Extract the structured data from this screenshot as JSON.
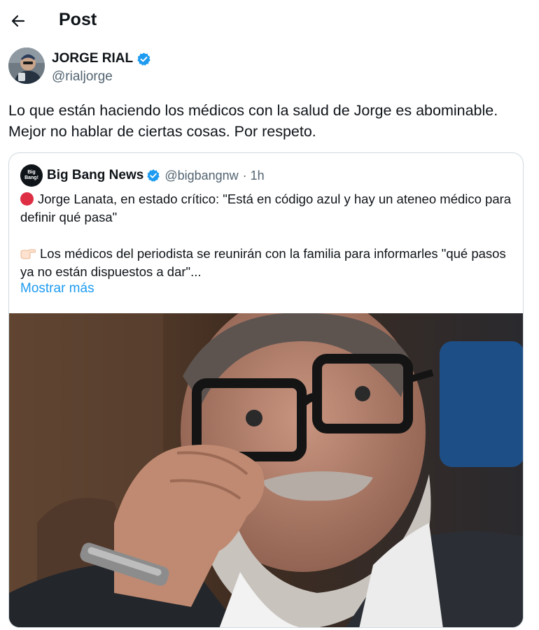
{
  "header": {
    "back_icon": "arrow-left-icon",
    "title": "Post"
  },
  "author": {
    "name": "JORGE RIAL",
    "handle": "@rialjorge",
    "verified": true,
    "verified_color": "#1d9bf0"
  },
  "post": {
    "lines": [
      "Lo que están haciendo los médicos con la salud de Jorge es abominable.",
      "Mejor no hablar de ciertas cosas. Por respeto."
    ]
  },
  "quoted_post": {
    "logo_text": [
      "Big",
      "Bang!"
    ],
    "name": "Big Bang News",
    "handle": "@bigbangnw",
    "time": "· 1h",
    "paragraph_1": "Jorge Lanata, en estado crítico: \"Está en código azul y hay un ateneo médico para definir qué pasa\"",
    "paragraph_2": "Los médicos del periodista se reunirán con la familia para informarles \"qué pasos ya no están dispuestos a dar\"...",
    "show_more": "Mostrar más",
    "paragraph_1_icon": "red-circle-icon",
    "paragraph_2_icon": "pointing-hand-icon"
  },
  "colors": {
    "text": "#0f1419",
    "secondary": "#536471",
    "link": "#1d9bf0",
    "border": "#cfd9de"
  }
}
